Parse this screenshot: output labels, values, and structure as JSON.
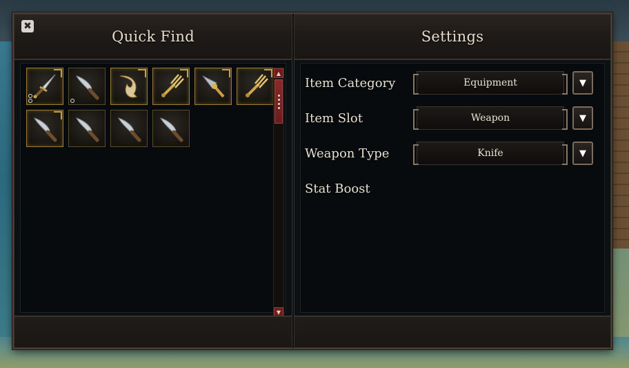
{
  "quick_find": {
    "title": "Quick Find",
    "close_label": "✖",
    "items": [
      {
        "icon": "dagger-icon",
        "name": "item-dagger-1",
        "gold": true,
        "dots": 2
      },
      {
        "icon": "knife-icon",
        "name": "item-knife-1",
        "gold": false,
        "dots": 1
      },
      {
        "icon": "sickle-icon",
        "name": "item-sickle",
        "gold": true,
        "dots": 0
      },
      {
        "icon": "fork-icon",
        "name": "item-fork-1",
        "gold": true,
        "dots": 0
      },
      {
        "icon": "spearhead-icon",
        "name": "item-spearhead",
        "gold": true,
        "dots": 0
      },
      {
        "icon": "fork-icon",
        "name": "item-fork-2",
        "gold": true,
        "dots": 0
      },
      {
        "icon": "knife-icon",
        "name": "item-knife-2",
        "gold": true,
        "dots": 0
      },
      {
        "icon": "knife-icon",
        "name": "item-knife-red",
        "gold": false,
        "dots": 0
      },
      {
        "icon": "knife-icon",
        "name": "item-knife-3",
        "gold": false,
        "dots": 0
      },
      {
        "icon": "knife-icon",
        "name": "item-knife-4",
        "gold": false,
        "dots": 0
      }
    ],
    "scroll_up": "▲",
    "scroll_down": "▼"
  },
  "settings": {
    "title": "Settings",
    "rows": [
      {
        "label": "Item Category",
        "value": "Equipment"
      },
      {
        "label": "Item Slot",
        "value": "Weapon"
      },
      {
        "label": "Weapon Type",
        "value": "Knife"
      },
      {
        "label": "Stat Boost",
        "value": null
      }
    ],
    "dropdown_icon": "▼"
  },
  "colors": {
    "panel_bg": "#0b1012",
    "frame": "#4a3f37",
    "title_text": "#e7dccf",
    "gold_border": "#9c7a34",
    "scroll_red": "#6e1d1f"
  }
}
